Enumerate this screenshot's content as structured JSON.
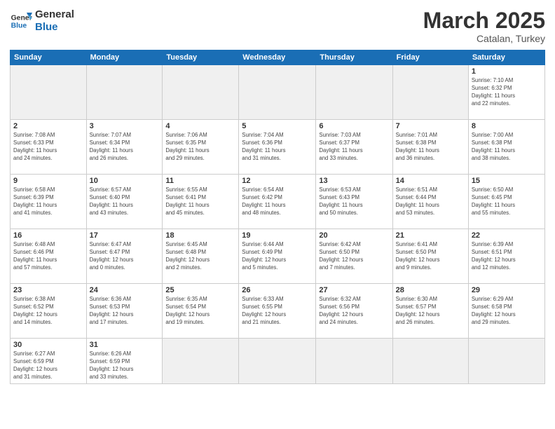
{
  "header": {
    "logo_general": "General",
    "logo_blue": "Blue",
    "month_title": "March 2025",
    "subtitle": "Catalan, Turkey"
  },
  "weekdays": [
    "Sunday",
    "Monday",
    "Tuesday",
    "Wednesday",
    "Thursday",
    "Friday",
    "Saturday"
  ],
  "weeks": [
    [
      {
        "day": null,
        "info": null
      },
      {
        "day": null,
        "info": null
      },
      {
        "day": null,
        "info": null
      },
      {
        "day": null,
        "info": null
      },
      {
        "day": null,
        "info": null
      },
      {
        "day": null,
        "info": null
      },
      {
        "day": "1",
        "info": "Sunrise: 7:10 AM\nSunset: 6:32 PM\nDaylight: 11 hours\nand 22 minutes."
      }
    ],
    [
      {
        "day": "2",
        "info": "Sunrise: 7:08 AM\nSunset: 6:33 PM\nDaylight: 11 hours\nand 24 minutes."
      },
      {
        "day": "3",
        "info": "Sunrise: 7:07 AM\nSunset: 6:34 PM\nDaylight: 11 hours\nand 26 minutes."
      },
      {
        "day": "4",
        "info": "Sunrise: 7:06 AM\nSunset: 6:35 PM\nDaylight: 11 hours\nand 29 minutes."
      },
      {
        "day": "5",
        "info": "Sunrise: 7:04 AM\nSunset: 6:36 PM\nDaylight: 11 hours\nand 31 minutes."
      },
      {
        "day": "6",
        "info": "Sunrise: 7:03 AM\nSunset: 6:37 PM\nDaylight: 11 hours\nand 33 minutes."
      },
      {
        "day": "7",
        "info": "Sunrise: 7:01 AM\nSunset: 6:38 PM\nDaylight: 11 hours\nand 36 minutes."
      },
      {
        "day": "8",
        "info": "Sunrise: 7:00 AM\nSunset: 6:38 PM\nDaylight: 11 hours\nand 38 minutes."
      }
    ],
    [
      {
        "day": "9",
        "info": "Sunrise: 6:58 AM\nSunset: 6:39 PM\nDaylight: 11 hours\nand 41 minutes."
      },
      {
        "day": "10",
        "info": "Sunrise: 6:57 AM\nSunset: 6:40 PM\nDaylight: 11 hours\nand 43 minutes."
      },
      {
        "day": "11",
        "info": "Sunrise: 6:55 AM\nSunset: 6:41 PM\nDaylight: 11 hours\nand 45 minutes."
      },
      {
        "day": "12",
        "info": "Sunrise: 6:54 AM\nSunset: 6:42 PM\nDaylight: 11 hours\nand 48 minutes."
      },
      {
        "day": "13",
        "info": "Sunrise: 6:53 AM\nSunset: 6:43 PM\nDaylight: 11 hours\nand 50 minutes."
      },
      {
        "day": "14",
        "info": "Sunrise: 6:51 AM\nSunset: 6:44 PM\nDaylight: 11 hours\nand 53 minutes."
      },
      {
        "day": "15",
        "info": "Sunrise: 6:50 AM\nSunset: 6:45 PM\nDaylight: 11 hours\nand 55 minutes."
      }
    ],
    [
      {
        "day": "16",
        "info": "Sunrise: 6:48 AM\nSunset: 6:46 PM\nDaylight: 11 hours\nand 57 minutes."
      },
      {
        "day": "17",
        "info": "Sunrise: 6:47 AM\nSunset: 6:47 PM\nDaylight: 12 hours\nand 0 minutes."
      },
      {
        "day": "18",
        "info": "Sunrise: 6:45 AM\nSunset: 6:48 PM\nDaylight: 12 hours\nand 2 minutes."
      },
      {
        "day": "19",
        "info": "Sunrise: 6:44 AM\nSunset: 6:49 PM\nDaylight: 12 hours\nand 5 minutes."
      },
      {
        "day": "20",
        "info": "Sunrise: 6:42 AM\nSunset: 6:50 PM\nDaylight: 12 hours\nand 7 minutes."
      },
      {
        "day": "21",
        "info": "Sunrise: 6:41 AM\nSunset: 6:50 PM\nDaylight: 12 hours\nand 9 minutes."
      },
      {
        "day": "22",
        "info": "Sunrise: 6:39 AM\nSunset: 6:51 PM\nDaylight: 12 hours\nand 12 minutes."
      }
    ],
    [
      {
        "day": "23",
        "info": "Sunrise: 6:38 AM\nSunset: 6:52 PM\nDaylight: 12 hours\nand 14 minutes."
      },
      {
        "day": "24",
        "info": "Sunrise: 6:36 AM\nSunset: 6:53 PM\nDaylight: 12 hours\nand 17 minutes."
      },
      {
        "day": "25",
        "info": "Sunrise: 6:35 AM\nSunset: 6:54 PM\nDaylight: 12 hours\nand 19 minutes."
      },
      {
        "day": "26",
        "info": "Sunrise: 6:33 AM\nSunset: 6:55 PM\nDaylight: 12 hours\nand 21 minutes."
      },
      {
        "day": "27",
        "info": "Sunrise: 6:32 AM\nSunset: 6:56 PM\nDaylight: 12 hours\nand 24 minutes."
      },
      {
        "day": "28",
        "info": "Sunrise: 6:30 AM\nSunset: 6:57 PM\nDaylight: 12 hours\nand 26 minutes."
      },
      {
        "day": "29",
        "info": "Sunrise: 6:29 AM\nSunset: 6:58 PM\nDaylight: 12 hours\nand 29 minutes."
      }
    ],
    [
      {
        "day": "30",
        "info": "Sunrise: 6:27 AM\nSunset: 6:59 PM\nDaylight: 12 hours\nand 31 minutes."
      },
      {
        "day": "31",
        "info": "Sunrise: 6:26 AM\nSunset: 6:59 PM\nDaylight: 12 hours\nand 33 minutes."
      },
      {
        "day": null,
        "info": null
      },
      {
        "day": null,
        "info": null
      },
      {
        "day": null,
        "info": null
      },
      {
        "day": null,
        "info": null
      },
      {
        "day": null,
        "info": null
      }
    ]
  ]
}
